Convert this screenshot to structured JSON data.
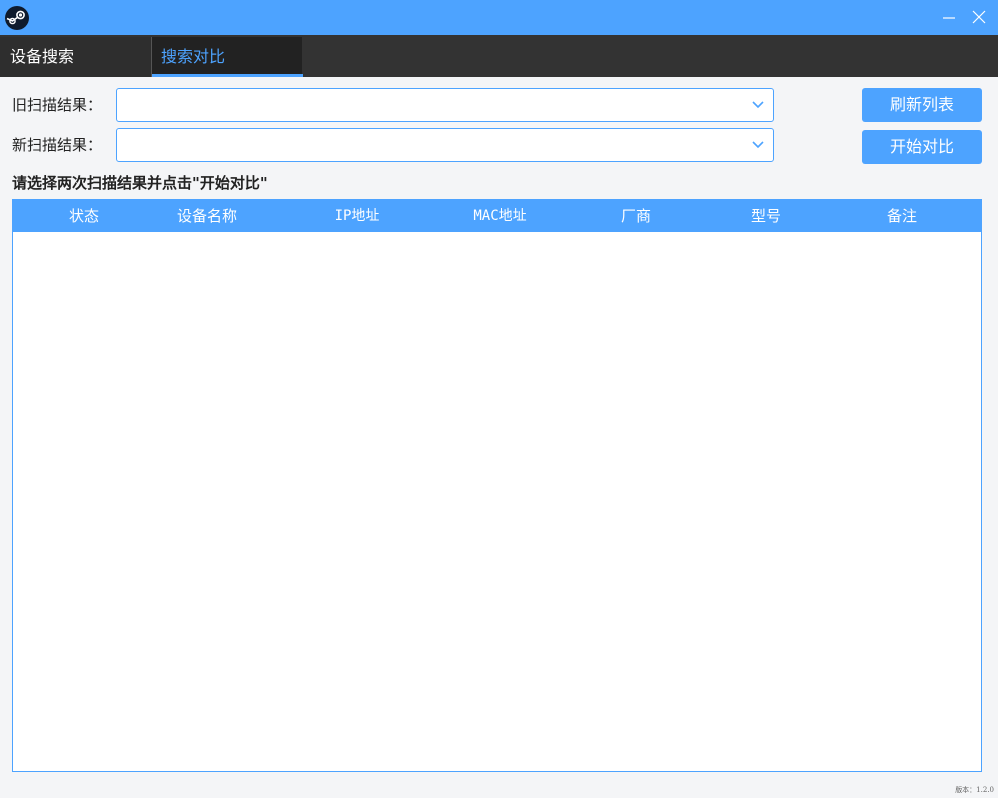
{
  "window": {
    "logo_icon": "steam-logo-icon",
    "controls": {
      "minimize_icon": "minimize-icon",
      "close_icon": "close-icon"
    }
  },
  "tabs": [
    {
      "label": "设备搜索",
      "active": false
    },
    {
      "label": "搜索对比",
      "active": true
    }
  ],
  "form": {
    "old_label": "旧扫描结果：",
    "old_value": "",
    "new_label": "新扫描结果：",
    "new_value": ""
  },
  "buttons": {
    "refresh_label": "刷新列表",
    "compare_label": "开始对比"
  },
  "hint": "请选择两次扫描结果并点击\"开始对比\"",
  "table": {
    "columns": [
      "状态",
      "设备名称",
      "IP地址",
      "MAC地址",
      "厂商",
      "型号",
      "备注"
    ],
    "rows": []
  },
  "version": "版本：1.2.0",
  "colors": {
    "accent": "#4da3ff",
    "tabbar": "#333333",
    "background": "#f4f5f7"
  }
}
